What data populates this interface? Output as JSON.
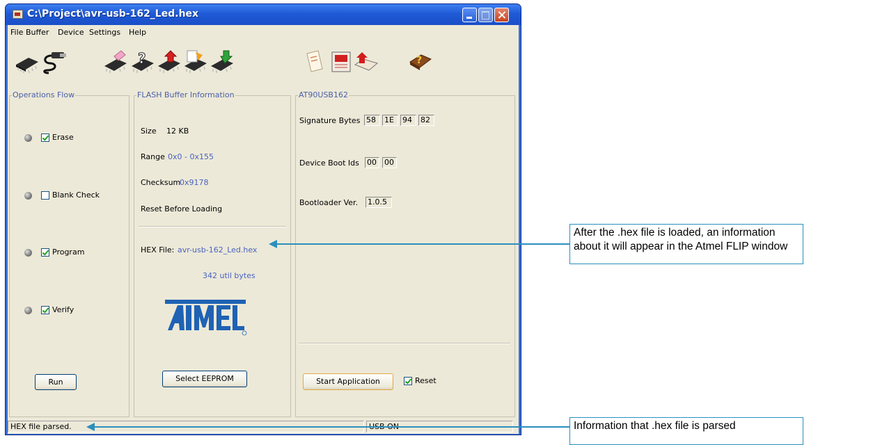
{
  "window": {
    "title": "C:\\Project\\avr-usb-162_Led.hex"
  },
  "menu": [
    "File",
    "Buffer",
    "Device",
    "Settings",
    "Help"
  ],
  "toolbar": {
    "icons": [
      "chip-select-icon",
      "usb-cable-icon",
      "erase-icon",
      "blank-check-icon",
      "program-icon",
      "verify-icon",
      "read-icon",
      "load-hex-icon",
      "save-buffer-icon",
      "edit-buffer-icon",
      "help-book-icon"
    ]
  },
  "operations": {
    "title": "Operations Flow",
    "items": [
      {
        "label": "Erase",
        "checked": true
      },
      {
        "label": "Blank Check",
        "checked": false
      },
      {
        "label": "Program",
        "checked": true
      },
      {
        "label": "Verify",
        "checked": true
      }
    ],
    "run_label": "Run"
  },
  "flash": {
    "title": "FLASH Buffer Information",
    "size_label": "Size",
    "size_value": "12 KB",
    "range_label": "Range",
    "range_value": "0x0 - 0x155",
    "checksum_label": "Checksum",
    "checksum_value": "0x9178",
    "reset_label": "Reset Before Loading",
    "hex_label": "HEX File:",
    "hex_value": "avr-usb-162_Led.hex",
    "bytes_text": "342 util bytes",
    "logo_text": "Atmel",
    "select_eeprom_label": "Select EEPROM"
  },
  "device": {
    "title": "AT90USB162",
    "signature_label": "Signature Bytes",
    "signature_bytes": [
      "58",
      "1E",
      "94",
      "82"
    ],
    "boot_ids_label": "Device Boot Ids",
    "boot_ids": [
      "00",
      "00"
    ],
    "bootloader_label": "Bootloader Ver.",
    "bootloader_value": "1.0.5",
    "start_app_label": "Start Application",
    "reset_label": "Reset",
    "reset_checked": true
  },
  "status": {
    "left": "HEX file parsed.",
    "right": "USB ON"
  },
  "callouts": {
    "top": "After the .hex file is loaded, an information about it will appear in the Atmel FLIP window",
    "bottom": "Information that .hex file is parsed"
  },
  "colors": {
    "callout_border": "#2b8fbd",
    "label_blue": "#4a62c0",
    "titlebar": "#1f5ad6"
  }
}
